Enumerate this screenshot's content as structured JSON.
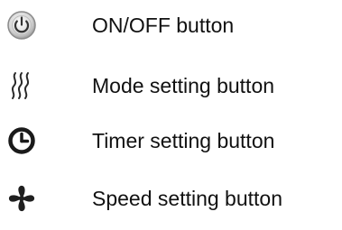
{
  "legend": {
    "items": [
      {
        "icon": "power-icon",
        "label": "ON/OFF button"
      },
      {
        "icon": "mode-waves-icon",
        "label": "Mode setting button"
      },
      {
        "icon": "clock-icon",
        "label": "Timer setting button"
      },
      {
        "icon": "fan-icon",
        "label": "Speed setting button"
      }
    ]
  }
}
